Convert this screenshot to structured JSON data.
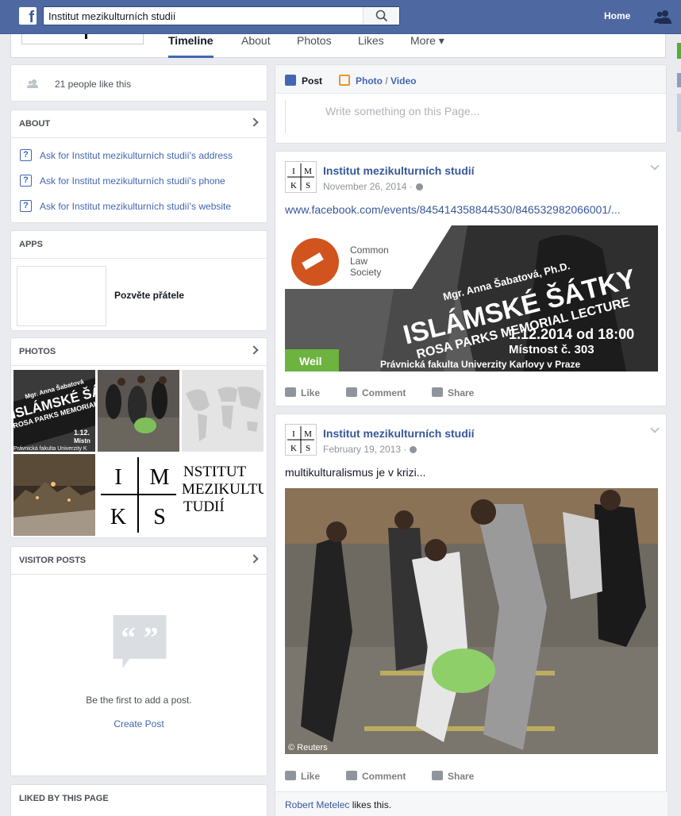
{
  "topbar": {
    "search_value": "Institut mezikulturních studií",
    "home_label": "Home"
  },
  "tabs": [
    {
      "label": "Timeline"
    },
    {
      "label": "About"
    },
    {
      "label": "Photos"
    },
    {
      "label": "Likes"
    },
    {
      "label": "More ▾"
    }
  ],
  "likes_box": {
    "text": "21 people like this"
  },
  "about": {
    "heading": "ABOUT",
    "items": [
      "Ask for Institut mezikulturních studií's address",
      "Ask for Institut mezikulturních studií's phone",
      "Ask for Institut mezikulturních studií's website"
    ]
  },
  "apps": {
    "heading": "APPS",
    "app_label": "Pozvěte přátele"
  },
  "photos": {
    "heading": "PHOTOS"
  },
  "visitor_posts": {
    "heading": "VISITOR POSTS",
    "message": "Be the first to add a post.",
    "create_label": "Create Post"
  },
  "liked_by": {
    "heading": "LIKED BY THIS PAGE"
  },
  "composer": {
    "post_tab": "Post",
    "photo_tab_a": "Photo",
    "photo_tab_sep": " / ",
    "photo_tab_b": "Video",
    "placeholder": "Write something on this Page..."
  },
  "posts": [
    {
      "author": "Institut mezikulturních studií",
      "date": "November 26, 2014",
      "link": "www.facebook.com/events/845414358844530/846532982066001/...",
      "image": {
        "logo_line1": "Common",
        "logo_line2": "Law",
        "logo_line3": "Society",
        "speaker": "Mgr. Anna Šabatová, Ph.D.",
        "title": "ISLÁMSKÉ ŠÁTKY",
        "subtitle": "ROSA PARKS MEMORIAL LECTURE",
        "datetime": "1.12.2014 od 18:00",
        "room": "Místnost č. 303",
        "venue": "Právnická fakulta Univerzity Karlovy v Praze",
        "sponsor": "Weil"
      },
      "actions": {
        "like": "Like",
        "comment": "Comment",
        "share": "Share"
      }
    },
    {
      "author": "Institut mezikulturních studií",
      "date": "February 19, 2013",
      "text": "multikulturalismus je v krizi...",
      "image_credit": "© Reuters",
      "actions": {
        "like": "Like",
        "comment": "Comment",
        "share": "Share"
      },
      "liker": "Robert Metelec",
      "likes_suffix": " likes this."
    }
  ],
  "imks_logo": {
    "letters": [
      "I",
      "M",
      "K",
      "S"
    ]
  },
  "photo_tiles": {
    "tile1_a": "Mgr. Anna Šabatová",
    "tile1_b": "ISLÁMSKÉ ŠÁ",
    "tile1_c": "ROSA PARKS MEMORIAL L",
    "tile1_d": "1.12.",
    "tile1_e": "Místn",
    "tile1_f": "Právnická fakulta Univerzity K",
    "tile6_a": "NSTITUT",
    "tile6_b": "MEZIKULTU",
    "tile6_c": "TUDIÍ"
  },
  "colors": {
    "brand": "#4e69a2",
    "link": "#365899",
    "accent": "#4267b2"
  }
}
